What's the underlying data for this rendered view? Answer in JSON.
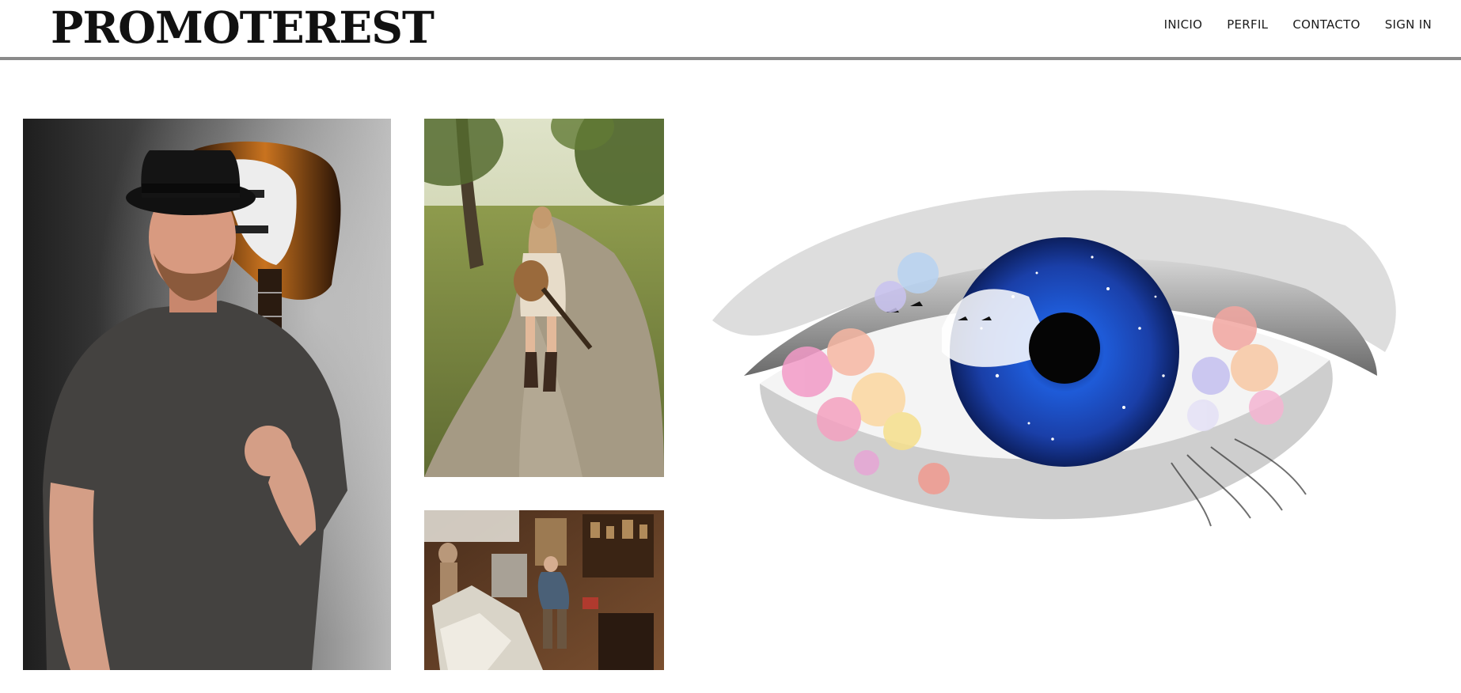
{
  "brand": {
    "logo_text": "PROMOTEREST"
  },
  "nav": {
    "items": [
      {
        "label": "INICIO"
      },
      {
        "label": "PERFIL"
      },
      {
        "label": "CONTACTO"
      },
      {
        "label": "SIGN IN"
      }
    ]
  },
  "gallery": {
    "images": [
      {
        "name": "man-with-guitar-photo"
      },
      {
        "name": "woman-with-guitar-on-path-photo"
      },
      {
        "name": "sculptor-workshop-photo"
      },
      {
        "name": "galaxy-eye-watercolor-illustration"
      }
    ]
  },
  "colors": {
    "header_rule": "#8a8a8a",
    "text": "#111111",
    "background": "#ffffff"
  }
}
